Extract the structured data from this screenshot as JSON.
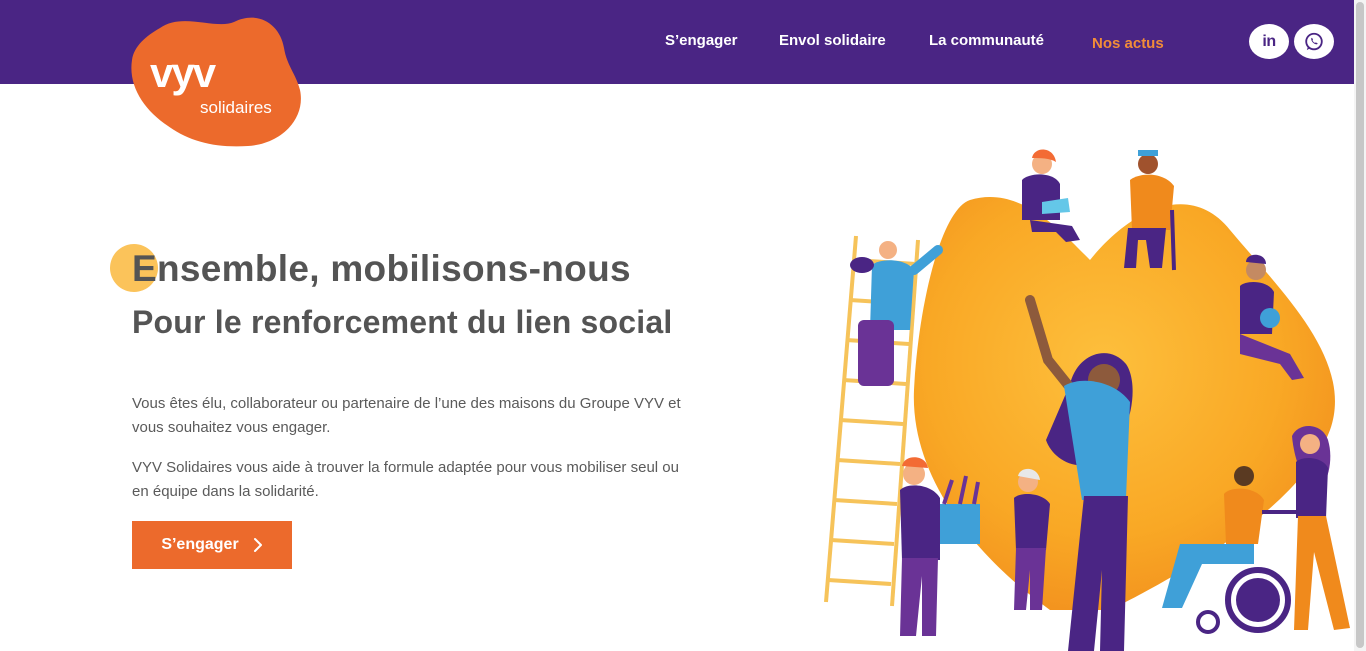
{
  "brand": {
    "logo_main": "vyv",
    "logo_sub": "solidaires",
    "primary_color": "#4a2584",
    "accent_color": "#ec6a2c",
    "highlight_color": "#f28c38",
    "dot_color": "#fbc35a"
  },
  "nav": {
    "items": [
      {
        "label": "S’engager",
        "active": false
      },
      {
        "label": "Envol solidaire",
        "active": false
      },
      {
        "label": "La communauté",
        "active": false
      },
      {
        "label": "Nos actus",
        "active": true
      }
    ],
    "social": [
      {
        "icon": "linkedin-icon",
        "glyph": "in"
      },
      {
        "icon": "whatsapp-icon"
      }
    ]
  },
  "hero": {
    "title": "Ensemble, mobilisons-nous",
    "subtitle": "Pour le renforcement du lien social",
    "paragraphs": [
      "Vous êtes élu, collaborateur ou partenaire de l’une des maisons du Groupe VYV et vous souhaitez vous engager.",
      "VYV Solidaires vous aide à trouver la formule adaptée pour vous mobiliser seul ou en équipe dans la solidarité."
    ],
    "cta_label": "S’engager",
    "cta_icon": "chevron-right-icon"
  },
  "illustration": {
    "icon": "community-illustration"
  }
}
